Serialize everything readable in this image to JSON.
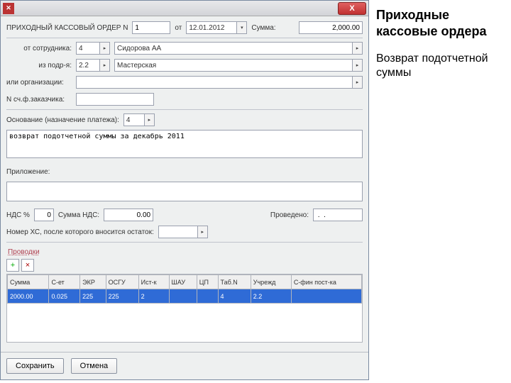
{
  "side": {
    "heading": "Приходные кассовые ордера",
    "paragraph": "Возврат подотчетной суммы"
  },
  "titlebar": {
    "close": "X"
  },
  "header": {
    "title": "ПРИХОДНЫЙ КАССОВЫЙ ОРДЕР N",
    "num": "1",
    "date_lbl": "от",
    "date": "12.01.2012",
    "sum_lbl": "Сумма:",
    "sum": "2,000.00"
  },
  "from": {
    "lbl_emp": "от  сотрудника:",
    "emp_code": "4",
    "emp_name": "Сидорова АА",
    "lbl_dept": "из  подр-я:",
    "dept_code": "2.2",
    "dept_name": "Мастерская",
    "lbl_org": "или организации:",
    "lbl_cust": "N сч.ф.заказчика:"
  },
  "basis": {
    "lbl": "Основание (назначение платежа):",
    "code": "4",
    "text": "возврат подотчетной суммы за декабрь 2011"
  },
  "attach": {
    "lbl": "Приложение:"
  },
  "vat": {
    "pct_lbl": "НДС %",
    "pct": "0",
    "sum_lbl": "Сумма НДС:",
    "sum": "0.00",
    "posted_lbl": "Проведено:",
    "posted": " .  ."
  },
  "xc": {
    "lbl": "Номер ХС, после которого вносится остаток:"
  },
  "tab": {
    "label": "Проводки"
  },
  "toolbar": {
    "add": "+",
    "del": "×"
  },
  "grid": {
    "headers": [
      "Сумма",
      "С-ет",
      "ЭКР",
      "ОСГУ",
      "Ист-к",
      "ШАУ",
      "ЦП",
      "Таб.N",
      "Учрежд",
      "С-фин пост-ка"
    ],
    "row": [
      "2000.00",
      "0.025",
      "225",
      "225",
      "2",
      "",
      "",
      "4",
      "2.2",
      ""
    ]
  },
  "buttons": {
    "save": "Сохранить",
    "cancel": "Отмена"
  }
}
